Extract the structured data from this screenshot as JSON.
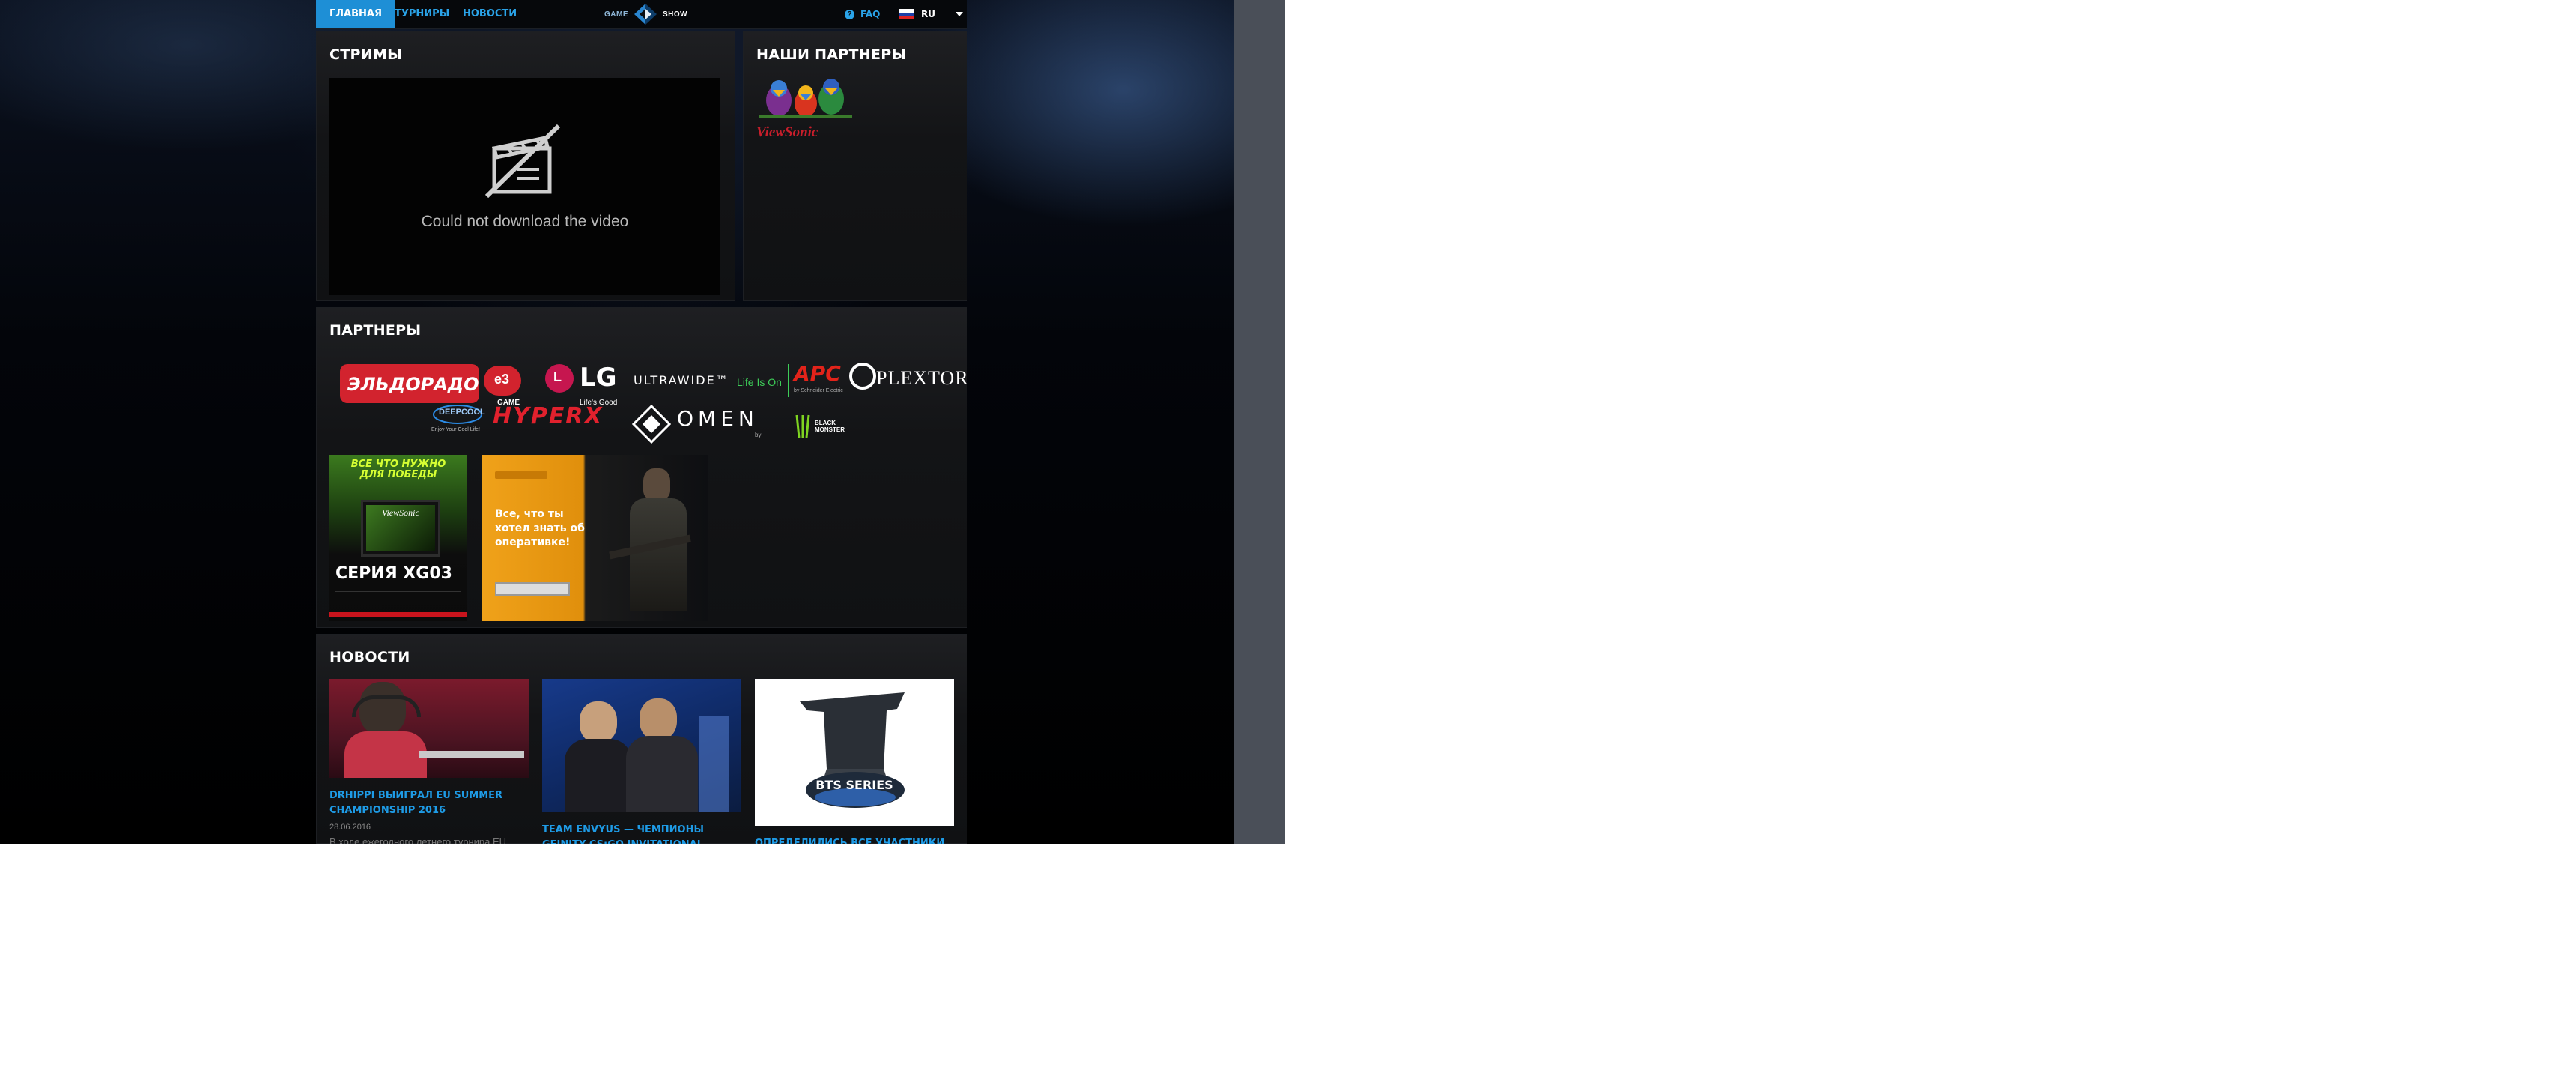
{
  "nav": {
    "items": [
      "ГЛАВНАЯ",
      "ТУРНИРЫ",
      "НОВОСТИ"
    ],
    "logo_left": "GAME",
    "logo_right": "SHOW",
    "faq": "FAQ",
    "lang": "RU"
  },
  "streams": {
    "title": "СТРИМЫ",
    "video_message": "Could not download the video"
  },
  "our_partners": {
    "title": "НАШИ ПАРТНЕРЫ",
    "logo_text": "ViewSonic"
  },
  "partners": {
    "title": "ПАРТНЕРЫ",
    "logos": [
      "ЭЛЬДОРАДО",
      "GAME",
      "LG",
      "Life's Good",
      "ULTRAWIDE™",
      "Life Is On",
      "APC",
      "by Schneider Electric",
      "PLEXTOR",
      "DEEPCOOL",
      "Enjoy Your Cool Life!",
      "HYPERX",
      "OMEN",
      "by",
      "BLACK MONSTER"
    ],
    "banner1": {
      "headline": "ВСЕ ЧТО НУЖНО ДЛЯ ПОБЕДЫ",
      "brand": "ViewSonic",
      "series": "СЕРИЯ XG03"
    },
    "banner2": {
      "text": "Все, что ты хотел знать об оперативке!"
    }
  },
  "news": {
    "title": "НОВОСТИ",
    "items": [
      {
        "title": "DRHIPPI ВЫИГРАЛ EU SUMMER CHAMPIONSHIP 2016",
        "date": "28.06.2016",
        "excerpt": "В ходе ежегодного летнего турнира EU"
      },
      {
        "title": "TEAM ENVYUS — ЧЕМПИОНЫ GFINITY CS:GO INVITATIONAL",
        "date": "",
        "excerpt": ""
      },
      {
        "title": "ОПРЕДЕЛИЛИСЬ ВСЕ УЧАСТНИКИ",
        "date": "",
        "excerpt": ""
      }
    ],
    "bts_label": "BTS SERIES"
  },
  "colors": {
    "accent": "#1e9be6",
    "nav_active": "#1e8fd6",
    "panel": "#131416"
  }
}
